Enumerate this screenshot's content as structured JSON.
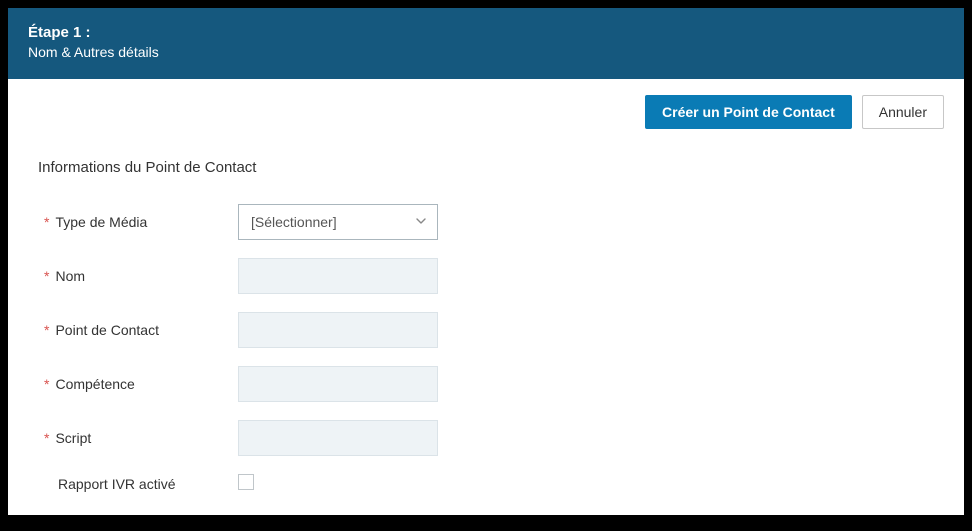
{
  "header": {
    "step": "Étape 1 :",
    "subtitle": "Nom & Autres détails"
  },
  "toolbar": {
    "create_label": "Créer un Point de Contact",
    "cancel_label": "Annuler"
  },
  "section": {
    "title": "Informations du Point de Contact"
  },
  "form": {
    "media_type": {
      "label": "Type de Média",
      "selected": "[Sélectionner]"
    },
    "name": {
      "label": "Nom",
      "value": ""
    },
    "contact_point": {
      "label": "Point de Contact",
      "value": ""
    },
    "skill": {
      "label": "Compétence",
      "value": ""
    },
    "script": {
      "label": "Script",
      "value": ""
    },
    "ivr_report": {
      "label": "Rapport IVR activé",
      "checked": false
    }
  },
  "required_marker": "*"
}
